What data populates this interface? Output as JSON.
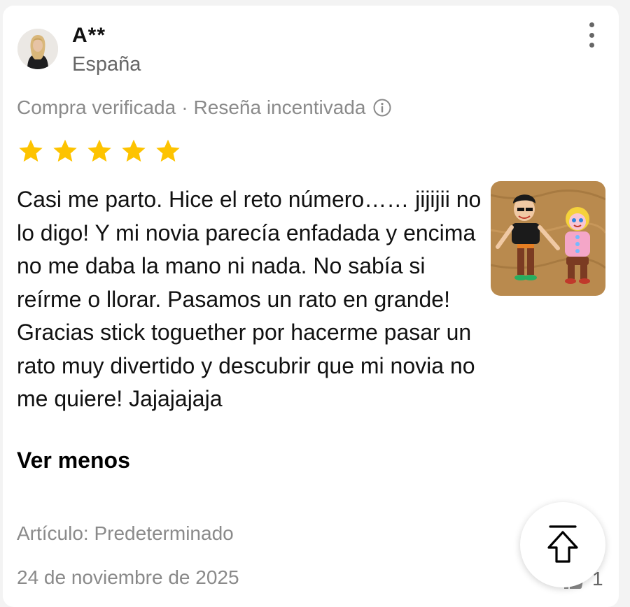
{
  "review": {
    "username": "A**",
    "country": "España",
    "verified_label": "Compra verificada",
    "separator": "·",
    "incentivized_label": "Reseña incentivada",
    "rating": 5,
    "text": "Casi me parto. Hice el reto número…… jijijii no lo digo! Y mi novia parecía enfadada y encima no me daba la mano ni nada. No sabía si reírme o llorar. Pasamos un rato en grande! Gracias stick toguether por hacerme pasar un rato muy divertido y descubrir que mi novia no me quiere! Jajajajaja",
    "see_less_label": "Ver menos",
    "item_label": "Artículo: Predeterminado",
    "date": "24 de noviembre de 2025",
    "helpful_count": "1"
  },
  "icons": {
    "more": "more-vertical-icon",
    "info": "info-icon",
    "star": "star-icon",
    "thumb": "thumbs-up-icon",
    "scroll_top": "scroll-to-top-icon"
  },
  "colors": {
    "star": "#FDC300",
    "muted_text": "#8a8a8a",
    "body_text": "#111111"
  }
}
